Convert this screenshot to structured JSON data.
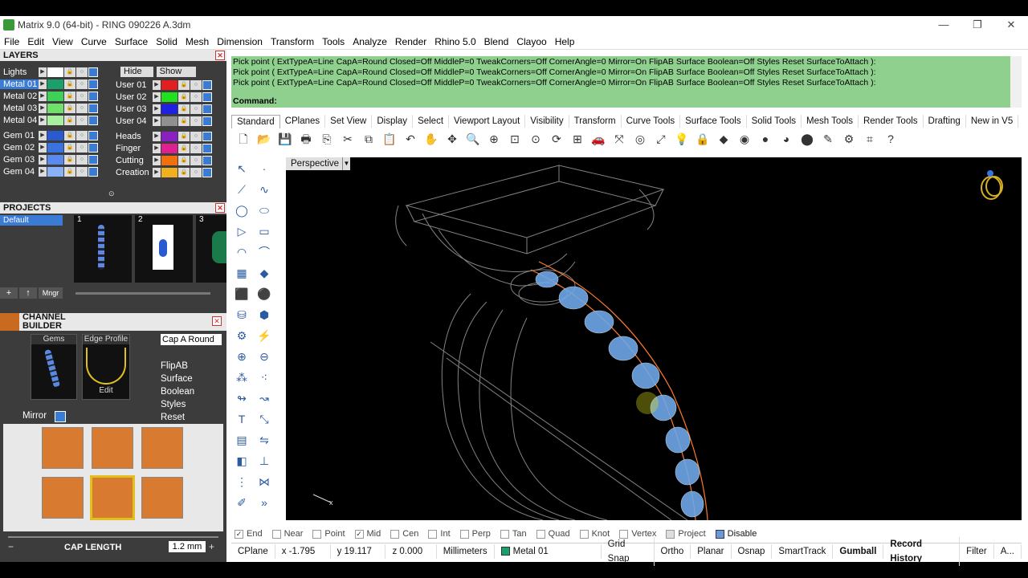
{
  "window": {
    "title": "Matrix 9.0 (64-bit) - RING 090226 A.3dm",
    "min": "—",
    "restore": "❐",
    "close": "✕"
  },
  "menu": [
    "File",
    "Edit",
    "View",
    "Curve",
    "Surface",
    "Solid",
    "Mesh",
    "Dimension",
    "Transform",
    "Tools",
    "Analyze",
    "Render",
    "Rhino 5.0",
    "Blend",
    "Clayoo",
    "Help"
  ],
  "layers": {
    "title": "LAYERS",
    "hide_label": "Hide",
    "show_label": "Show",
    "left": [
      {
        "name": "Lights",
        "color": "#ffffff",
        "selected": false
      },
      {
        "name": "Metal 01",
        "color": "#1aa06a",
        "selected": true
      },
      {
        "name": "Metal 02",
        "color": "#3fd05a",
        "selected": false
      },
      {
        "name": "Metal 03",
        "color": "#6fe06a",
        "selected": false
      },
      {
        "name": "Metal 04",
        "color": "#a8f0a0",
        "selected": false
      },
      {
        "name": "Gem 01",
        "color": "#2a5ad0",
        "selected": false
      },
      {
        "name": "Gem 02",
        "color": "#3a72e0",
        "selected": false
      },
      {
        "name": "Gem 03",
        "color": "#5a8af0",
        "selected": false
      },
      {
        "name": "Gem 04",
        "color": "#8ab0f5",
        "selected": false
      }
    ],
    "right": [
      {
        "name": "User 01",
        "color": "#e02020"
      },
      {
        "name": "User 02",
        "color": "#20e020"
      },
      {
        "name": "User 03",
        "color": "#2020e0"
      },
      {
        "name": "User 04",
        "color": "#909090"
      },
      {
        "name": "Heads",
        "color": "#8a20c0"
      },
      {
        "name": "Finger",
        "color": "#e02090"
      },
      {
        "name": "Cutting",
        "color": "#f07010"
      },
      {
        "name": "Creation",
        "color": "#f0b020"
      }
    ]
  },
  "projects": {
    "title": "PROJECTS",
    "default_label": "Default",
    "thumb_numbers": [
      "1",
      "2",
      "3"
    ],
    "add": "+",
    "up": "↑",
    "mngr": "Mngr"
  },
  "channel": {
    "title_line1": "CHANNEL",
    "title_line2": "BUILDER",
    "gems_label": "Gems",
    "edge_label": "Edge Profile",
    "edit_label": "Edit",
    "cap_dropdown": "Cap A Round",
    "options": [
      "FlipAB",
      "Surface",
      "Boolean",
      "Styles",
      "Reset"
    ],
    "mirror_label": "Mirror",
    "cap_length_label": "CAP LENGTH",
    "cap_length_value": "1.2 mm",
    "minus": "−",
    "plus": "+"
  },
  "command": {
    "history": [
      "Pick point ( ExtTypeA=Line  CapA=Round  Closed=Off  MiddleP=0  TweakCorners=Off  CornerAngle=0  Mirror=On  FlipAB  Surface  Boolean=Off  Styles  Reset  SurfaceToAttach ):",
      "Pick point ( ExtTypeA=Line  CapA=Round  Closed=Off  MiddleP=0  TweakCorners=Off  CornerAngle=0  Mirror=On  FlipAB  Surface  Boolean=Off  Styles  Reset  SurfaceToAttach ):",
      "Pick point ( ExtTypeA=Line  CapA=Round  Closed=Off  MiddleP=0  TweakCorners=Off  CornerAngle=0  Mirror=On  FlipAB  Surface  Boolean=Off  Styles  Reset  SurfaceToAttach ):"
    ],
    "prompt": "Command:"
  },
  "toolbar_tabs": [
    "Standard",
    "CPlanes",
    "Set View",
    "Display",
    "Select",
    "Viewport Layout",
    "Visibility",
    "Transform",
    "Curve Tools",
    "Surface Tools",
    "Solid Tools",
    "Mesh Tools",
    "Render Tools",
    "Drafting",
    "New in V5"
  ],
  "viewport": {
    "label": "Perspective"
  },
  "osnaps": [
    {
      "label": "End",
      "checked": true
    },
    {
      "label": "Near",
      "checked": false
    },
    {
      "label": "Point",
      "checked": false
    },
    {
      "label": "Mid",
      "checked": true
    },
    {
      "label": "Cen",
      "checked": false
    },
    {
      "label": "Int",
      "checked": false
    },
    {
      "label": "Perp",
      "checked": false
    },
    {
      "label": "Tan",
      "checked": false
    },
    {
      "label": "Quad",
      "checked": false
    },
    {
      "label": "Knot",
      "checked": false
    },
    {
      "label": "Vertex",
      "checked": false
    },
    {
      "label": "Project",
      "checked": false
    },
    {
      "label": "Disable",
      "checked": false
    }
  ],
  "status": {
    "cplane": "CPlane",
    "x": "x -1.795",
    "y": "y 19.117",
    "z": "z 0.000",
    "units": "Millimeters",
    "layer": "Metal 01",
    "items": [
      "Grid Snap",
      "Ortho",
      "Planar",
      "Osnap",
      "SmartTrack",
      "Gumball",
      "Record History",
      "Filter",
      "A..."
    ]
  }
}
